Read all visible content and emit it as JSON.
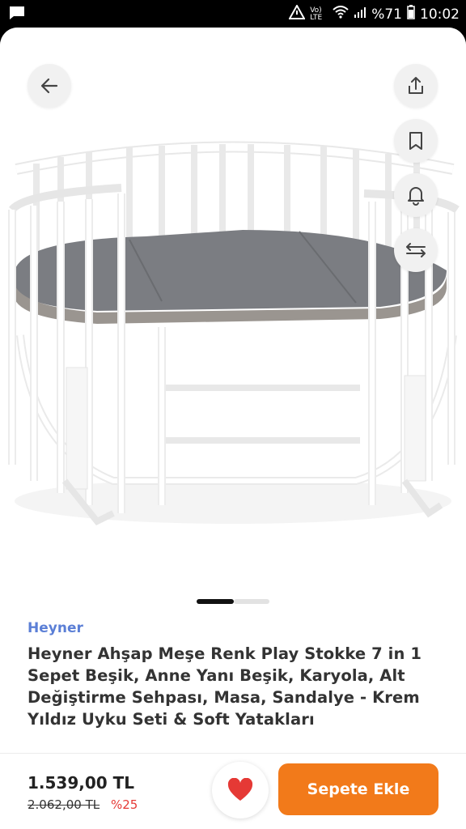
{
  "status_bar": {
    "battery": "%71",
    "time": "10:02",
    "network": "Vo) LTE"
  },
  "gallery": {
    "back_icon": "arrow-left-icon",
    "actions": [
      "share-icon",
      "bookmark-icon",
      "bell-icon",
      "compare-arrows-icon"
    ],
    "current_slide": 1,
    "total_indicators": 2
  },
  "product": {
    "brand": "Heyner",
    "title": "Heyner Ahşap Meşe Renk Play Stokke 7 in 1 Sepet Beşik, Anne Yanı Beşik, Karyola, Alt Değiştirme Sehpası, Masa, Sandalye - Krem Yıldız Uyku Seti & Soft Yatakları"
  },
  "purchase": {
    "price": "1.539,00 TL",
    "old_price": "2.062,00 TL",
    "discount": "%25",
    "favorite_icon": "heart-icon",
    "add_to_cart": "Sepete Ekle"
  },
  "colors": {
    "accent": "#f27a1a",
    "brand_link": "#5b7fd6",
    "discount": "#e53935",
    "favorite": "#e53935"
  }
}
